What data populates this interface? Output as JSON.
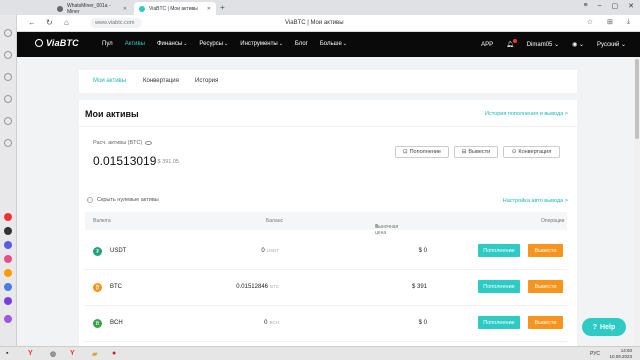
{
  "browser": {
    "tabs": [
      {
        "label": "WhatsMiner_001a - Miner"
      },
      {
        "label": "ViaBTC | Мои активы"
      }
    ],
    "url": "www.viabtc.com",
    "page_title": "ViaBTC | Мои активы"
  },
  "header": {
    "logo": "ViaBTC",
    "nav": [
      "Пул",
      "Активы",
      "Финансы",
      "Ресурсы",
      "Инструменты",
      "Блог",
      "Больше"
    ],
    "app": "APP",
    "user": "Dimam05",
    "language": "Русский"
  },
  "subnav": {
    "tabs": [
      "Мои активы",
      "Конвертация",
      "История"
    ]
  },
  "assets": {
    "title": "Мои активы",
    "history_link": "История пополнения и вывода >",
    "estimated_label": "Расч. активы  (BTC)",
    "estimated_value": "0.01513019",
    "estimated_usd": "≈ $ 391.05",
    "actions": [
      "Пополнение",
      "Вывести",
      "Конвертация"
    ],
    "hide_zero": "Скрыть нулевые активы",
    "auto_withdraw": "Настройка авто вывода >"
  },
  "table": {
    "headers": {
      "currency": "Валюта",
      "balance": "Баланс",
      "market": "Рыночная цена",
      "ops": "Операции"
    },
    "rows": [
      {
        "coin": "USDT",
        "balance": "0",
        "unit": "USDT",
        "market": "$ 0",
        "icon_color": "#26a17b",
        "icon_letter": "₮"
      },
      {
        "coin": "BTC",
        "balance": "0.01512846",
        "unit": "BTC",
        "market": "$ 391",
        "icon_color": "#f7931a",
        "icon_letter": "₿"
      },
      {
        "coin": "BCH",
        "balance": "0",
        "unit": "BCH",
        "market": "$ 0",
        "icon_color": "#3aa34a",
        "icon_letter": "B"
      }
    ],
    "deposit_label": "Пополнение",
    "withdraw_label": "Вывести"
  },
  "help": "Help",
  "taskbar": {
    "lang": "РУС",
    "time": "14:50",
    "date": "10.09.2023"
  },
  "colors": {
    "accent": "#2ecbc4",
    "withdraw": "#f7941d",
    "header_bg": "#0a0a0a"
  }
}
